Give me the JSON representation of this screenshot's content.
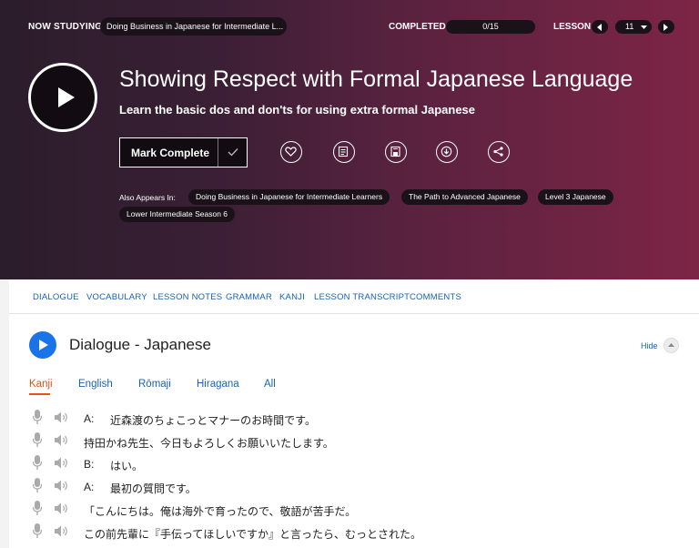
{
  "topbar": {
    "now_studying": "NOW STUDYING",
    "course": "Doing Business in Japanese for Intermediate L...",
    "completed_label": "COMPLETED",
    "progress": "0/15",
    "lesson_label": "LESSON",
    "lesson_number": "11"
  },
  "lesson": {
    "title": "Showing Respect with Formal Japanese Language",
    "subtitle": "Learn the basic dos and don'ts for using extra formal Japanese",
    "mark_complete": "Mark Complete"
  },
  "actions": [
    "heart-icon",
    "notes-icon",
    "save-icon",
    "download-icon",
    "share-icon"
  ],
  "also_appears": {
    "label": "Also Appears In:",
    "tags": [
      "Doing Business in Japanese for Intermediate Learners",
      "The Path to Advanced Japanese",
      "Level 3 Japanese",
      "Lower Intermediate Season 6"
    ]
  },
  "tabs": [
    "DIALOGUE",
    "VOCABULARY",
    "LESSON NOTES",
    "GRAMMAR",
    "KANJI",
    "LESSON TRANSCRIPT",
    "COMMENTS"
  ],
  "dialogue": {
    "title": "Dialogue - Japanese",
    "hide": "Hide",
    "script_tabs": [
      "Kanji",
      "English",
      "Rōmaji",
      "Hiragana",
      "All"
    ],
    "active_tab": "Kanji",
    "lines": [
      {
        "speaker": "A:",
        "text": "近森渡のちょこっとマナーのお時間です。"
      },
      {
        "speaker": "",
        "text": "持田かね先生、今日もよろしくお願いいたします。"
      },
      {
        "speaker": "B:",
        "text": "はい。"
      },
      {
        "speaker": "A:",
        "text": "最初の質問です。"
      },
      {
        "speaker": "",
        "text": "「こんにちは。俺は海外で育ったので、敬語が苦手だ。"
      },
      {
        "speaker": "",
        "text": "この前先輩に『手伝ってほしいですか』と言ったら、むっとされた。"
      }
    ]
  },
  "colors": {
    "accent_blue": "#1a73e8",
    "link": "#1762b6",
    "active_tab": "#e8501b"
  }
}
